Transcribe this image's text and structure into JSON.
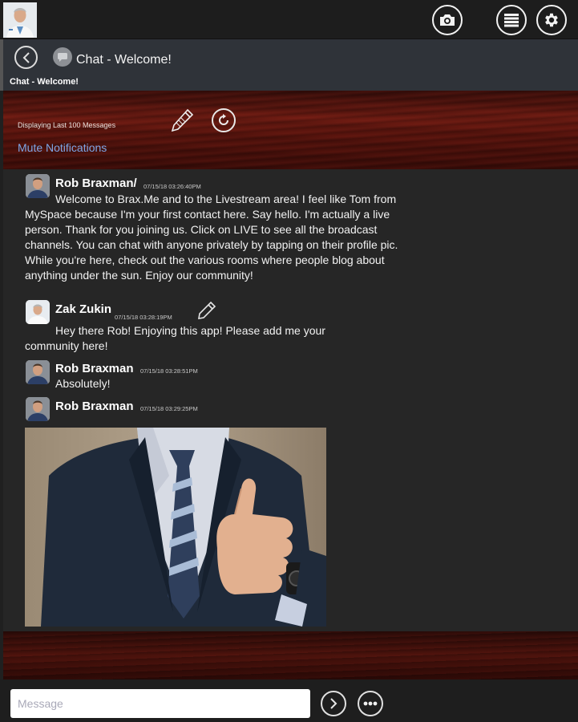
{
  "topbar": {
    "icons": [
      "camera-icon",
      "list-icon",
      "gear-icon"
    ]
  },
  "chat": {
    "title": "Chat - Welcome!",
    "subtitle": "Chat - Welcome!"
  },
  "banner": {
    "info": "Displaying Last 100 Messages",
    "mute_label": "Mute Notifications"
  },
  "messages": [
    {
      "sender": "Rob Braxman/",
      "timestamp": "07/15/18 03:26:40PM",
      "text": "Welcome to Brax.Me and to the Livestream area! I feel like Tom from MySpace because I'm your first contact here. Say hello. I'm actually a live person. Thank for you joining us. Click on LIVE to see all the broadcast channels. You can chat with anyone privately by tapping on their profile pic. While you're here, check out the various rooms where people blog about anything under the sun. Enjoy our community!"
    },
    {
      "sender": "Zak Zukin",
      "timestamp": "07/15/18 03:28:19PM",
      "text": "Hey there Rob! Enjoying this app! Please add me your community here!"
    },
    {
      "sender": "Rob Braxman",
      "timestamp": "07/15/18 03:28:51PM",
      "text": "Absolutely!"
    },
    {
      "sender": "Rob Braxman",
      "timestamp": "07/15/18 03:29:25PM",
      "text": ""
    }
  ],
  "composer": {
    "placeholder": "Message"
  },
  "colors": {
    "link": "#7fa6e6",
    "background": "#262626",
    "wood": "#6e1b12"
  }
}
